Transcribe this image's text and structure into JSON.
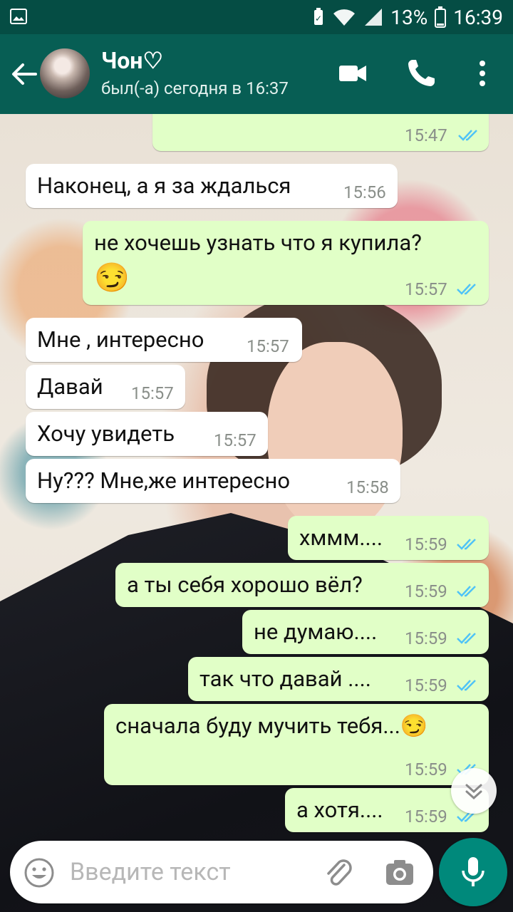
{
  "status_bar": {
    "battery": "13%",
    "time": "16:39"
  },
  "header": {
    "name": "Чон♡",
    "status": "был(-а) сегодня в 16:37"
  },
  "messages": [
    {
      "dir": "out",
      "text": "",
      "time": "15:47"
    },
    {
      "dir": "in",
      "text": "Наконец, а я за ждалься",
      "time": "15:56"
    },
    {
      "dir": "out",
      "text": "не хочешь узнать что я купила?",
      "emoji": "😏",
      "time": "15:57"
    },
    {
      "dir": "in",
      "text": "Мне , интересно",
      "time": "15:57"
    },
    {
      "dir": "in",
      "text": "Давай",
      "time": "15:57"
    },
    {
      "dir": "in",
      "text": "Хочу увидеть",
      "time": "15:57"
    },
    {
      "dir": "in",
      "text": "Ну??? Мне,же интересно",
      "time": "15:58"
    },
    {
      "dir": "out",
      "text": "хммм....",
      "time": "15:59"
    },
    {
      "dir": "out",
      "text": "а ты себя хорошо вёл?",
      "time": "15:59"
    },
    {
      "dir": "out",
      "text": "не думаю....",
      "time": "15:59"
    },
    {
      "dir": "out",
      "text": "так что давай ....",
      "time": "15:59"
    },
    {
      "dir": "out",
      "text": "сначала буду мучить тебя...😏",
      "time": "15:59"
    },
    {
      "dir": "out",
      "text": "а хотя....",
      "time": "15:59"
    }
  ],
  "input": {
    "placeholder": "Введите текст"
  },
  "icons": {
    "back": "arrow-left-icon",
    "video": "video-camera-icon",
    "call": "phone-icon",
    "menu": "more-vert-icon",
    "emoji": "emoji-icon",
    "attach": "paperclip-icon",
    "camera": "camera-icon",
    "mic": "microphone-icon",
    "scroll": "chevron-double-down-icon"
  },
  "colors": {
    "header": "#075e54",
    "outgoing": "#e1ffc7",
    "incoming": "#ffffff",
    "tick_read": "#4fc3f7",
    "fab": "#00897b"
  }
}
